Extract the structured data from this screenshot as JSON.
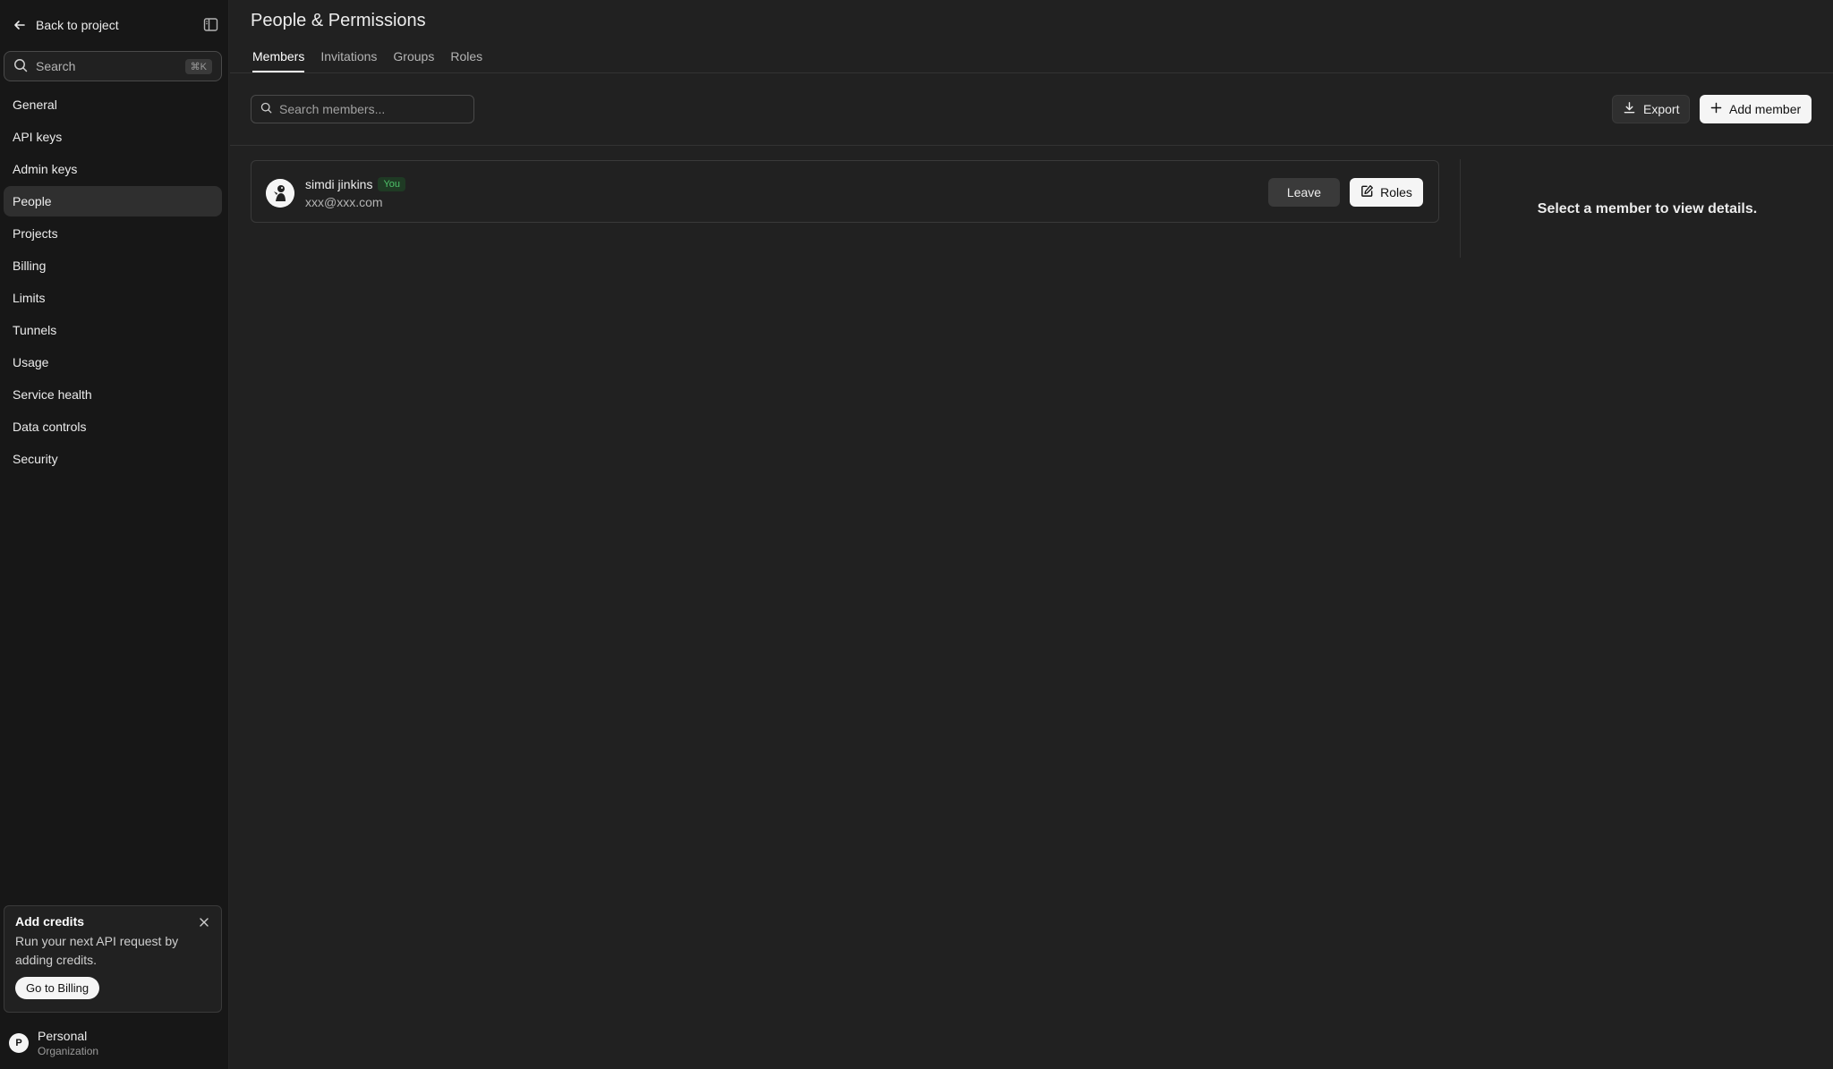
{
  "sidebar": {
    "back_label": "Back to project",
    "search": {
      "placeholder": "Search",
      "shortcut": "⌘K"
    },
    "items": [
      {
        "label": "General",
        "active": false
      },
      {
        "label": "API keys",
        "active": false
      },
      {
        "label": "Admin keys",
        "active": false
      },
      {
        "label": "People",
        "active": true
      },
      {
        "label": "Projects",
        "active": false
      },
      {
        "label": "Billing",
        "active": false
      },
      {
        "label": "Limits",
        "active": false
      },
      {
        "label": "Tunnels",
        "active": false
      },
      {
        "label": "Usage",
        "active": false
      },
      {
        "label": "Service health",
        "active": false
      },
      {
        "label": "Data controls",
        "active": false
      },
      {
        "label": "Security",
        "active": false
      }
    ],
    "credits": {
      "title": "Add credits",
      "description": "Run your next API request by adding credits.",
      "button_label": "Go to Billing"
    },
    "org": {
      "initial": "P",
      "name": "Personal",
      "type": "Organization"
    }
  },
  "main": {
    "title": "People & Permissions",
    "tabs": [
      {
        "label": "Members",
        "active": true
      },
      {
        "label": "Invitations",
        "active": false
      },
      {
        "label": "Groups",
        "active": false
      },
      {
        "label": "Roles",
        "active": false
      }
    ],
    "member_search": {
      "placeholder": "Search members...",
      "value": ""
    },
    "export_label": "Export",
    "add_member_label": "Add member",
    "members": [
      {
        "name": "simdi jinkins",
        "badge": "You",
        "email": "xxx@xxx.com",
        "leave_label": "Leave",
        "roles_label": "Roles"
      }
    ],
    "details_placeholder": "Select a member to view details."
  },
  "colors": {
    "background": "#212121",
    "sidebar_bg": "#171717",
    "badge_text": "#4ec26a",
    "badge_bg": "#1f3a24",
    "primary_button": "#f5f5f5"
  },
  "icons": {
    "back": "arrow-left-icon",
    "collapse": "sidebar-toggle-icon",
    "search": "search-icon",
    "close": "close-icon",
    "export": "download-icon",
    "add": "plus-icon",
    "roles": "edit-icon"
  }
}
